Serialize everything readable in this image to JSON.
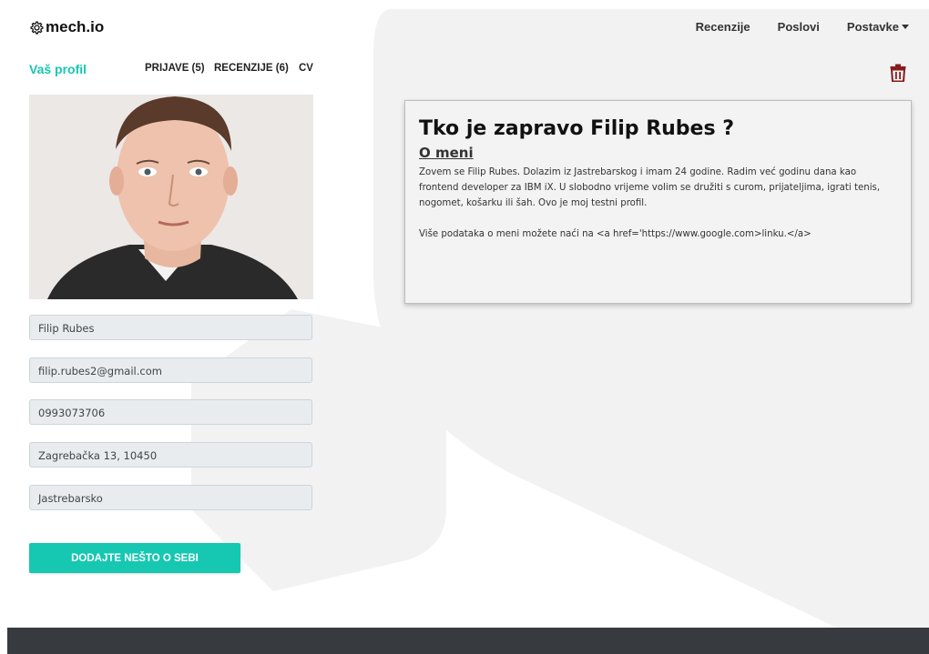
{
  "brand": {
    "name": "mech.io",
    "icon": "gear-icon"
  },
  "nav": {
    "reviews": "Recenzije",
    "jobs": "Poslovi",
    "settings": "Postavke"
  },
  "profile_tabs": {
    "active": "Vaš profil",
    "applications": "PRIJAVE (5)",
    "reviews": "RECENZIJE (6)",
    "cv": "CV"
  },
  "profile": {
    "name": "Filip Rubes",
    "email": "filip.rubes2@gmail.com",
    "phone": "0993073706",
    "address": "Zagrebačka 13, 10450",
    "city": "Jastrebarsko"
  },
  "actions": {
    "add_about": "DODAJTE NEŠTO O SEBI",
    "delete_icon": "trash-icon"
  },
  "about": {
    "title": "Tko je zapravo Filip Rubes ?",
    "subtitle": "O meni",
    "paragraph1": "Zovem se Filip Rubes. Dolazim iz Jastrebarskog i imam 24 godine. Radim već godinu dana kao frontend developer za IBM iX. U slobodno vrijeme volim se družiti s curom, prijateljima, igrati tenis, nogomet, košarku ili šah. Ovo je moj testni profil.",
    "paragraph2": "Više podataka o meni možete naći na <a href='https://www.google.com>linku.</a>"
  },
  "colors": {
    "accent": "#16c7b1",
    "danger": "#8b1a1a",
    "footer": "#373a3e"
  }
}
